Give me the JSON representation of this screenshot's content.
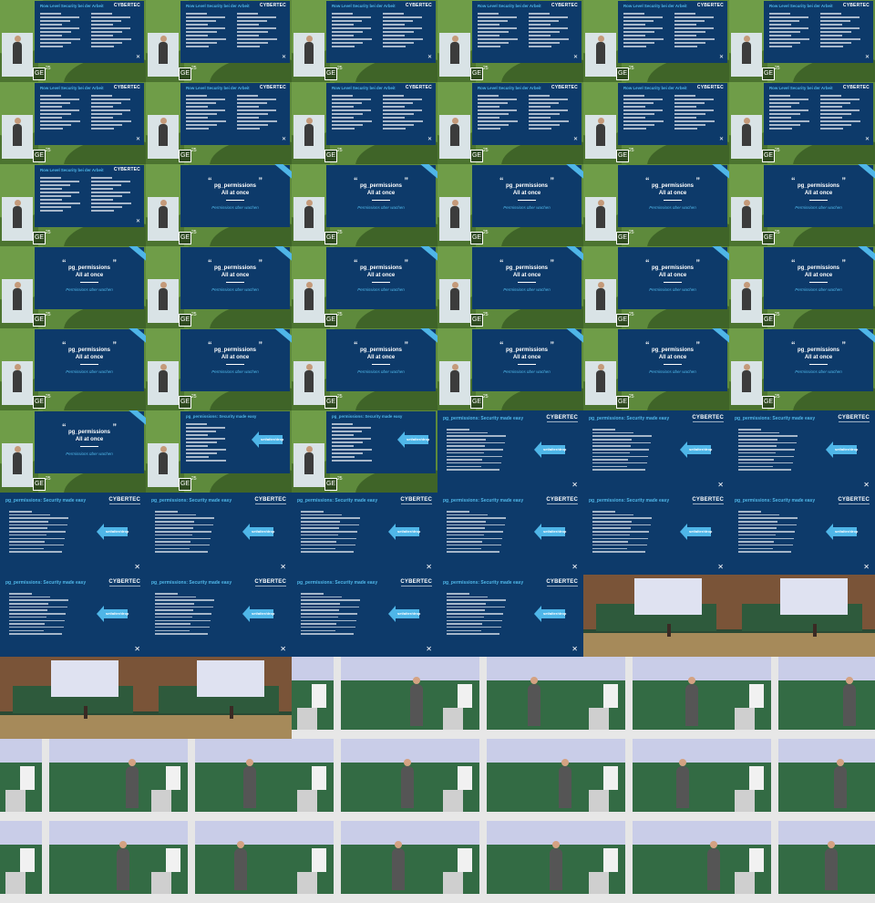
{
  "slides": {
    "rls": {
      "title": "Row Level Security bei der Arbeit",
      "brand": "CYBERTEC"
    },
    "quote": {
      "line1": "pg_permissions",
      "line2": "All at once",
      "sub": "Permissions über wachen"
    },
    "easy": {
      "title": "pg_permissions: Security made easy",
      "brand": "CYBERTEC",
      "arrow_label": "set/alter/drop"
    }
  },
  "overlay": {
    "logo": "GE",
    "year": "25"
  },
  "grid": {
    "cols": 6,
    "cells": [
      "rls",
      "rls",
      "rls",
      "rls",
      "rls",
      "rls",
      "rls",
      "rls",
      "rls",
      "rls",
      "rls",
      "rls",
      "rls",
      "quote",
      "quote",
      "quote",
      "quote",
      "quote",
      "quote",
      "quote",
      "quote",
      "quote",
      "quote",
      "quote",
      "quote",
      "quote",
      "quote",
      "quote",
      "quote",
      "quote",
      "quote",
      "easy-proj",
      "easy-proj",
      "easy",
      "easy",
      "easy",
      "easy",
      "easy",
      "easy",
      "easy",
      "easy",
      "easy",
      "easy",
      "easy",
      "easy",
      "easy",
      "hall",
      "hall",
      "hall",
      "hall",
      "close",
      "close",
      "close",
      "close",
      "close",
      "close",
      "close",
      "close",
      "close",
      "close",
      "close",
      "close",
      "close",
      "close",
      "close",
      "close"
    ]
  }
}
